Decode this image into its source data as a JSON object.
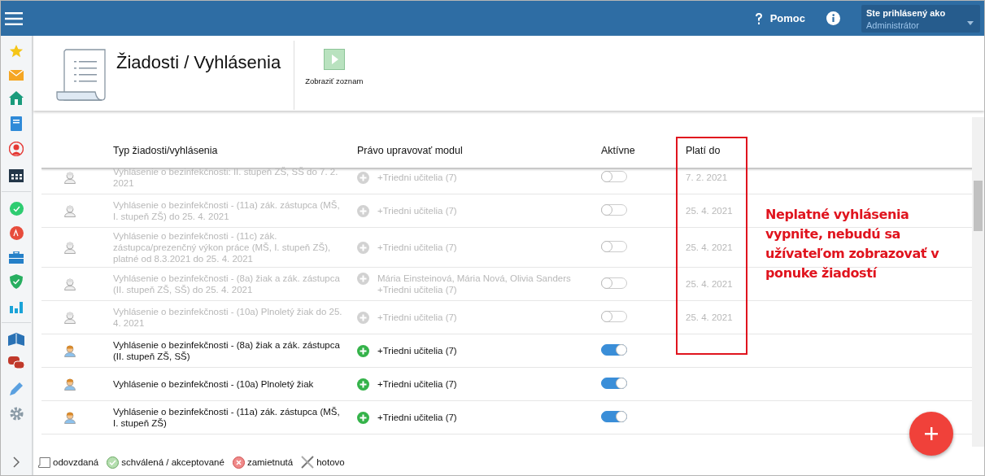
{
  "topbar": {
    "help_label": "Pomoc",
    "user_label": "Ste prihlásený ako",
    "user_value": "Administrátor"
  },
  "header": {
    "title": "Žiadosti / Vyhlásenia",
    "action_label": "Zobraziť zoznam"
  },
  "table": {
    "columns": [
      "Typ žiadosti/vyhlásenia",
      "Právo upravovať modul",
      "Aktívne",
      "Platí do"
    ],
    "rows": [
      {
        "type": "Vyhlásenie o bezinfekčnosti: II. stupeň ZŠ, SŠ do 7. 2. 2021",
        "rights": "+Triedni učitelia (7)",
        "active": false,
        "valid_to": "7. 2. 2021"
      },
      {
        "type": "Vyhlásenie o bezinfekčnosti - (11a) zák. zástupca (MŠ, I. stupeň ZŠ) do 25. 4. 2021",
        "rights": "+Triedni učitelia (7)",
        "active": false,
        "valid_to": "25. 4. 2021"
      },
      {
        "type": "Vyhlásenie o bezinfekčnosti - (11c) zák. zástupca/prezenčný výkon práce (MŠ, I. stupeň ZŠ), platné od 8.3.2021 do 25. 4. 2021",
        "rights": "+Triedni učitelia (7)",
        "active": false,
        "valid_to": "25. 4. 2021"
      },
      {
        "type": "Vyhlásenie o bezinfekčnosti - (8a) žiak a zák. zástupca (II. stupeň ZŠ, SŠ) do 25. 4. 2021",
        "rights": "Mária Einsteinová, Mária Nová, Olivia Sanders +Triedni učitelia (7)",
        "active": false,
        "valid_to": "25. 4. 2021"
      },
      {
        "type": "Vyhlásenie o bezinfekčnosti - (10a) Plnoletý žiak do 25. 4. 2021",
        "rights": "+Triedni učitelia (7)",
        "active": false,
        "valid_to": "25. 4. 2021"
      },
      {
        "type": "Vyhlásenie o bezinfekčnosti - (8a) žiak a zák. zástupca (II. stupeň ZŠ, SŠ)",
        "rights": "+Triedni učitelia (7)",
        "active": true
      },
      {
        "type": "Vyhlásenie o bezinfekčnosti - (10a) Plnoletý žiak",
        "rights": "+Triedni učitelia (7)",
        "active": true
      },
      {
        "type": "Vyhlásenie o bezinfekčnosti - (11a) zák. zástupca (MŠ, I. stupeň ZŠ)",
        "rights": "+Triedni učitelia (7)",
        "active": true
      }
    ]
  },
  "annotation": "Neplatné vyhlásenia vypnite, nebudú sa užívateľom zobrazovať v ponuke žiadostí",
  "legend": [
    {
      "kind": "sent",
      "label": "odovzdaná"
    },
    {
      "kind": "approved",
      "label": "schválená / akceptované"
    },
    {
      "kind": "rejected",
      "label": "zamietnutá"
    },
    {
      "kind": "done",
      "label": "hotovo"
    }
  ]
}
